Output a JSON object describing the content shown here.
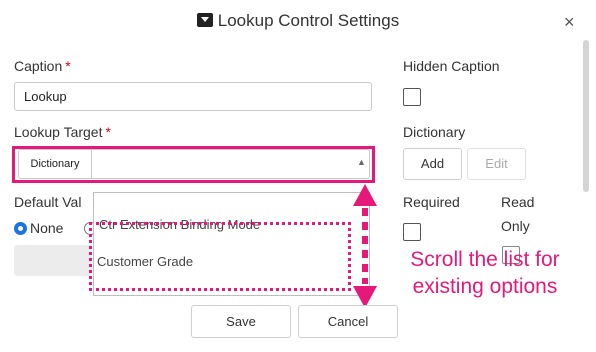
{
  "dialog": {
    "title": "Lookup Control Settings",
    "close": "×"
  },
  "caption": {
    "label": "Caption",
    "required_mark": "*",
    "value": "Lookup"
  },
  "lookup_target": {
    "label": "Lookup Target",
    "required_mark": "*",
    "chip": "Dictionary",
    "dropdown_arrow": "▲"
  },
  "default_value": {
    "label": "Default Val",
    "radio_none": "None"
  },
  "dropdown_list": {
    "items": [
      "Ctr Extension Binding Mode",
      "Customer Grade"
    ]
  },
  "hidden_caption": {
    "label": "Hidden Caption"
  },
  "dictionary": {
    "label": "Dictionary",
    "add_label": "Add",
    "edit_label": "Edit"
  },
  "required": {
    "label": "Required"
  },
  "read_only": {
    "label_line1": "Read",
    "label_line2": "Only"
  },
  "footer": {
    "save_label": "Save",
    "cancel_label": "Cancel"
  },
  "annotation": {
    "line1": "Scroll the list for",
    "line2": "existing options",
    "color": "#e6197a"
  }
}
